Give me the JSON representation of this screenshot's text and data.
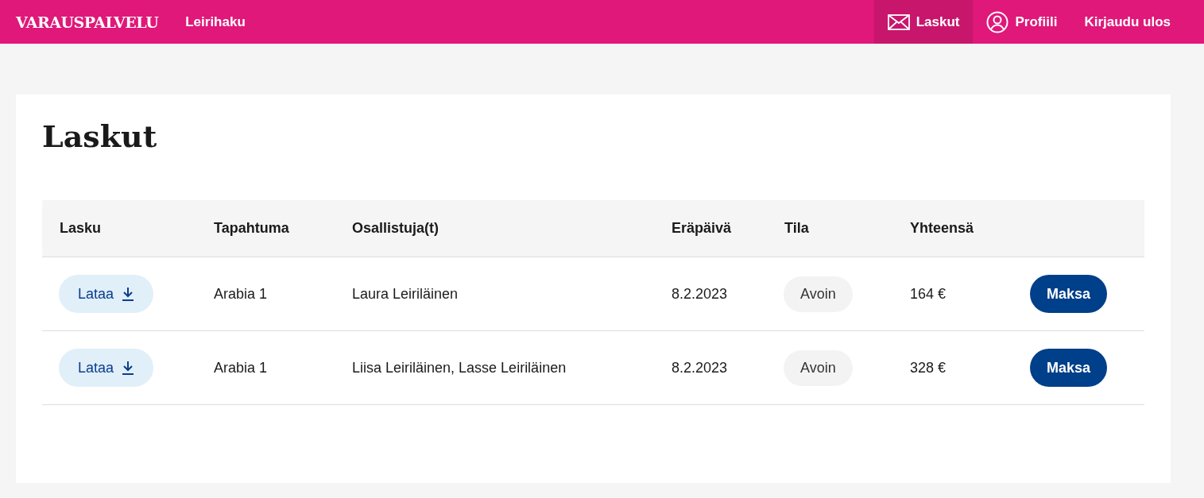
{
  "nav": {
    "brand": "VARAUSPALVELU",
    "links": [
      {
        "label": "Leirihaku"
      }
    ],
    "items": [
      {
        "kind": "mail",
        "label": "Laskut",
        "selected": true
      },
      {
        "kind": "user",
        "label": "Profiili",
        "selected": false
      },
      {
        "kind": "plain",
        "label": "Kirjaudu ulos",
        "selected": false
      }
    ]
  },
  "page": {
    "title": "Laskut"
  },
  "table": {
    "columns": [
      "Lasku",
      "Tapahtuma",
      "Osallistuja(t)",
      "Eräpäivä",
      "Tila",
      "Yhteensä"
    ],
    "rows": [
      {
        "download": "Lataa",
        "event": "Arabia 1",
        "participants": "Laura Leiriläinen",
        "due": "8.2.2023",
        "status": "Avoin",
        "total": "164 €",
        "pay": "Maksa"
      },
      {
        "download": "Lataa",
        "event": "Arabia 1",
        "participants": "Liisa Leiriläinen, Lasse Leiriläinen",
        "due": "8.2.2023",
        "status": "Avoin",
        "total": "328 €",
        "pay": "Maksa"
      }
    ]
  }
}
